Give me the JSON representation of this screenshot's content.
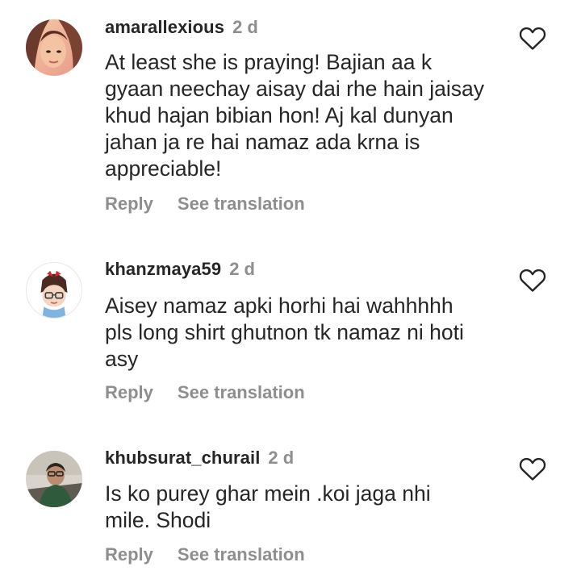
{
  "comments": [
    {
      "username": "amarallexious",
      "time": "2 d",
      "lines": [
        "At least she is praying! Bajian aa k",
        "gyaan neechay aisay dai rhe hain jaisay",
        "khud hajan bibian hon! Aj kal dunyan",
        "jahan ja re hai namaz ada krna is",
        "appreciable!"
      ],
      "reply_label": "Reply",
      "translate_label": "See translation"
    },
    {
      "username": "khanzmaya59",
      "time": "2 d",
      "lines": [
        "Aisey namaz apki horhi hai wahhhhh",
        "pls long shirt ghutnon tk namaz ni hoti",
        "asy"
      ],
      "reply_label": "Reply",
      "translate_label": "See translation"
    },
    {
      "username": "khubsurat_churail",
      "time": "2 d",
      "lines": [
        "Is ko purey ghar mein .koi jaga nhi",
        "mile. Shodi"
      ],
      "reply_label": "Reply",
      "translate_label": "See translation"
    }
  ],
  "icons": {
    "like": "heart-outline-icon"
  },
  "colors": {
    "primary_text": "#262626",
    "secondary_text": "#8e8e8e",
    "background": "#ffffff"
  }
}
